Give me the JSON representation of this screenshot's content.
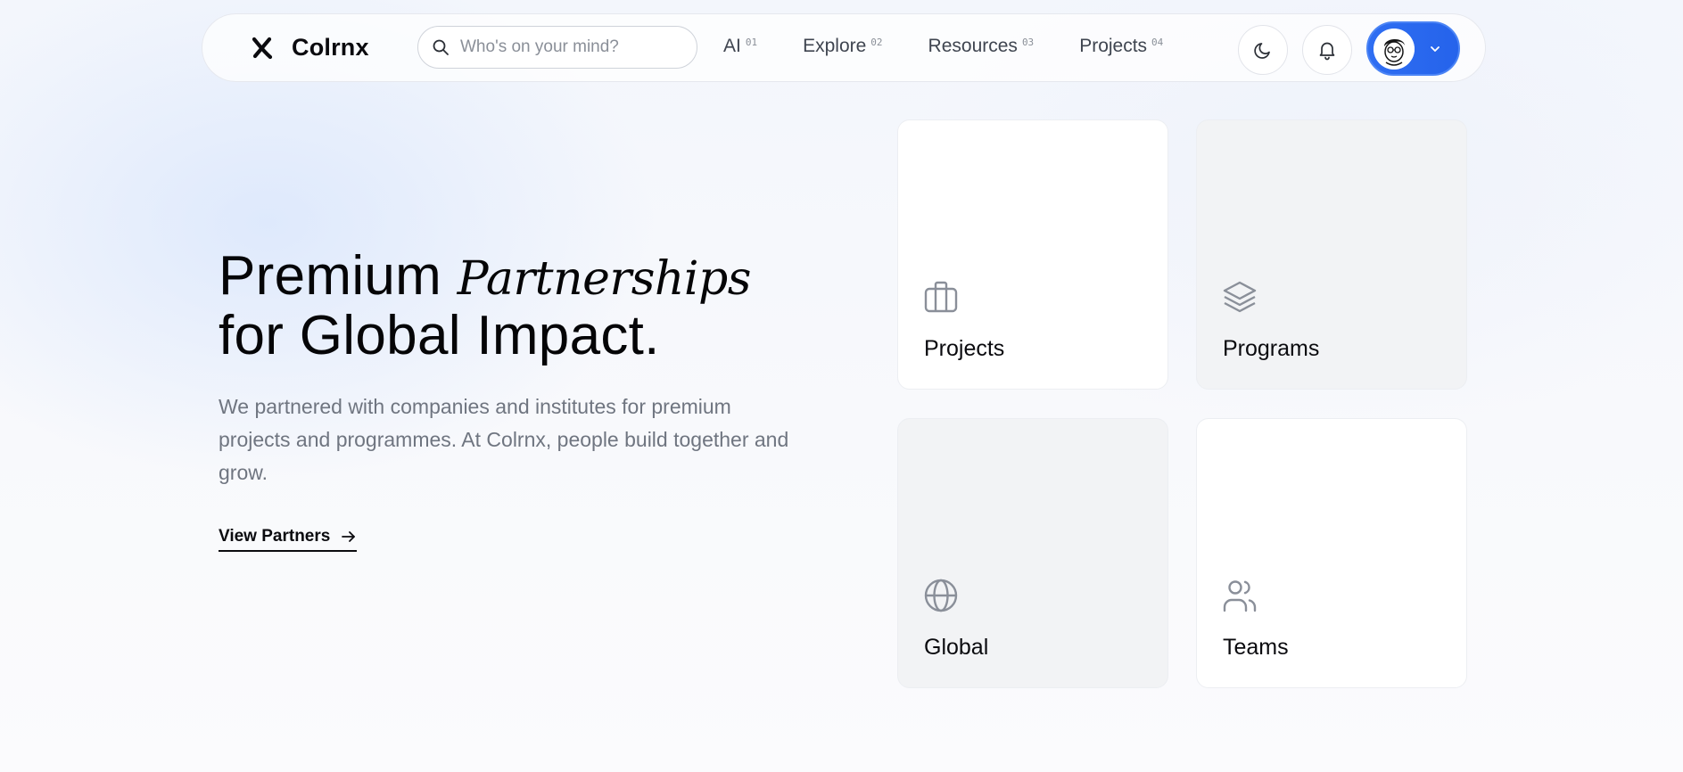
{
  "brand": {
    "name": "Colrnx",
    "icon": "x-logo-icon"
  },
  "search": {
    "placeholder": "Who's on your mind?",
    "icon": "search-icon"
  },
  "nav": {
    "links": [
      {
        "label": "AI",
        "num": "01"
      },
      {
        "label": "Explore",
        "num": "02"
      },
      {
        "label": "Resources",
        "num": "03"
      },
      {
        "label": "Projects",
        "num": "04"
      }
    ],
    "theme_icon": "moon-icon",
    "notifications_icon": "bell-icon",
    "profile_icon": "avatar",
    "profile_chevron": "chevron-down-icon"
  },
  "hero": {
    "title_word1": "Premium",
    "title_serif": "Partnerships",
    "title_line2": "for Global Impact.",
    "description": "We partnered with companies and institutes for premium projects and programmes. At Colrnx, people build together and grow.",
    "cta_label": "View Partners",
    "cta_icon": "arrow-right-icon"
  },
  "cards": [
    {
      "label": "Projects",
      "icon": "briefcase-icon",
      "style": "white"
    },
    {
      "label": "Programs",
      "icon": "layers-icon",
      "style": "gray"
    },
    {
      "label": "Global",
      "icon": "globe-icon",
      "style": "gray"
    },
    {
      "label": "Teams",
      "icon": "users-icon",
      "style": "white"
    }
  ],
  "colors": {
    "accent": "#2563eb",
    "text_dark": "#0b0b0f",
    "text_muted": "#6f7580",
    "icon_gray": "#8a8f99"
  }
}
